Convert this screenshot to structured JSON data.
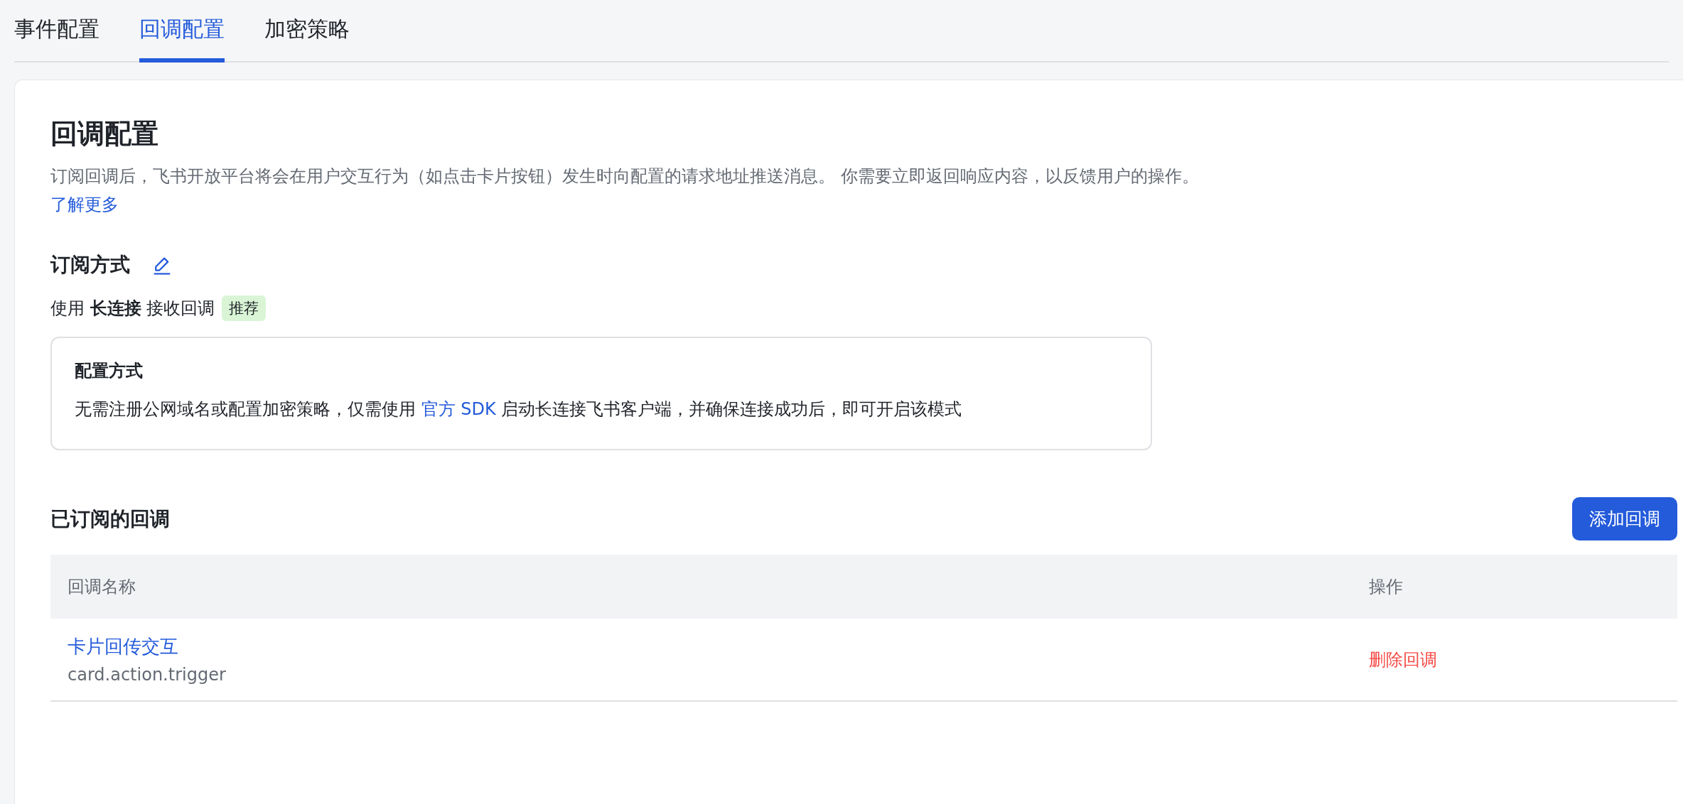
{
  "tabs": [
    {
      "label": "事件配置",
      "selected": false
    },
    {
      "label": "回调配置",
      "selected": true
    },
    {
      "label": "加密策略",
      "selected": false
    }
  ],
  "page": {
    "title": "回调配置",
    "description": "订阅回调后，飞书开放平台将会在用户交互行为（如点击卡片按钮）发生时向配置的请求地址推送消息。 你需要立即返回响应内容，以反馈用户的操作。",
    "description_link": "了解更多"
  },
  "subscription": {
    "heading": "订阅方式",
    "mode": "使用 **长连接** 接收回调",
    "badge": "推荐",
    "info": {
      "title": "配置方式",
      "text_before": "无需注册公网域名或配置加密策略，仅需使用 ",
      "link": "官方 SDK",
      "text_after": " 启动长连接飞书客户端，并确保连接成功后，即可开启该模式"
    }
  },
  "subscribed": {
    "heading": "已订阅的回调",
    "add_button": "添加回调",
    "columns": [
      "回调名称",
      "操作"
    ],
    "rows": [
      {
        "name": "卡片回传交互",
        "event": "card.action.trigger",
        "action": "删除回调"
      }
    ]
  }
}
